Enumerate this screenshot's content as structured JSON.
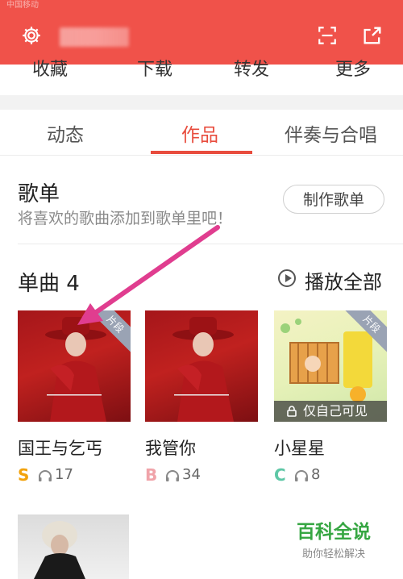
{
  "status_bar": {
    "carrier": "中国移动"
  },
  "header": {
    "icons": [
      "gear-icon",
      "scan-icon",
      "share-icon"
    ]
  },
  "actions_row": [
    "收藏",
    "下载",
    "转发",
    "更多"
  ],
  "tabs": [
    {
      "label": "动态"
    },
    {
      "label": "作品",
      "active": true
    },
    {
      "label": "伴奏与合唱"
    }
  ],
  "playlist": {
    "title": "歌单",
    "subtitle": "将喜欢的歌曲添加到歌单里吧！",
    "make_button": "制作歌单"
  },
  "singles": {
    "title": "单曲 4",
    "play_all": "播放全部",
    "songs": [
      {
        "title": "国王与乞丐",
        "grade": "S",
        "plays": "17",
        "badge": "片段"
      },
      {
        "title": "我管你",
        "grade": "B",
        "plays": "34"
      },
      {
        "title": "小星星",
        "grade": "C",
        "plays": "8",
        "badge": "片段",
        "private": "仅自己可见"
      }
    ]
  },
  "watermark": {
    "title": "百科全说",
    "subtitle": "助你轻松解决"
  },
  "colors": {
    "brand_red": "#f0524a",
    "tab_active": "#e84c3d",
    "grade_s": "#f2a20c",
    "grade_b": "#f0a3a9",
    "grade_c": "#5ec7a6",
    "arrow": "#e03d8f",
    "watermark": "#36a642"
  }
}
